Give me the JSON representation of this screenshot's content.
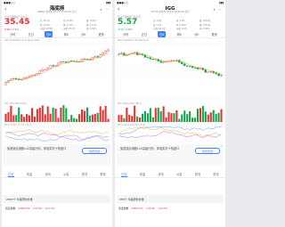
{
  "phones": [
    {
      "statusbar": {
        "left": "●●●○○",
        "right": "▮▮▮"
      },
      "title": "海底捞",
      "subtitle": "06862 交易中 07-16 15:06:49 北京",
      "tagline": "互动互通数据产品交互",
      "quote": {
        "price": "35.45",
        "change": "0.60 1.72%",
        "stats": [
          {
            "label": "高",
            "value": "36.13"
          },
          {
            "label": "开",
            "value": "34.80"
          },
          {
            "label": "量",
            "value": "765万"
          },
          {
            "label": "低",
            "value": "34.60"
          },
          {
            "label": "换",
            "value": "0.31%"
          },
          {
            "label": "额",
            "value": "2.71亿"
          },
          {
            "label": "市值",
            "value": "1879亿"
          },
          {
            "label": "市盈",
            "value": "87.53"
          },
          {
            "label": "振",
            "value": "4.39%"
          }
        ]
      },
      "tabs": [
        "分时",
        "五日",
        "日K",
        "周K",
        "月K",
        "更多"
      ],
      "active_tab": 2,
      "ma_label": "MA5 34.86  MA10 34.11  MA20 33.56",
      "vol_label": "VOL 765万  MA5 1012万",
      "kdj_label": "KDJ K:71.62 D:72.37 J:70.11",
      "promo": {
        "text": "免费激活港股Lv2高级行情，体验实时十档盘口",
        "button": "免费激活",
        "close": "✕"
      },
      "bottom_tabs": [
        "讨论",
        "资金",
        "资讯",
        "公告",
        "简况",
        "财务"
      ],
      "active_bottom_tab": 0,
      "news": {
        "text": "2053个 牛股研判文章",
        "arrow": "›"
      },
      "index_row": {
        "name": "恒生指数",
        "value": "24452.00",
        "change": "+31.60",
        "pct": "+0.13%"
      },
      "colors": {
        "up": "#e93030",
        "down": "#14a44c"
      }
    },
    {
      "statusbar": {
        "left": "●●●○○",
        "right": "▮▮▮"
      },
      "title": "IGG",
      "subtitle": "00799 交易中 07-16 15:06:49 北京",
      "tagline": "互动互通数据产品交互",
      "quote": {
        "price": "5.57",
        "change": "-0.17 -3.0%",
        "stats": [
          {
            "label": "高",
            "value": "5.65"
          },
          {
            "label": "开",
            "value": "5.64"
          },
          {
            "label": "量",
            "value": "1032万"
          },
          {
            "label": "低",
            "value": "5.53"
          },
          {
            "label": "换",
            "value": "0.86%"
          },
          {
            "label": "额",
            "value": "5744万"
          },
          {
            "label": "市值",
            "value": "66.9亿"
          },
          {
            "label": "市盈",
            "value": "9.05"
          },
          {
            "label": "振",
            "value": "2.09%"
          }
        ]
      },
      "tabs": [
        "分时",
        "五日",
        "日K",
        "周K",
        "月K",
        "更多"
      ],
      "active_tab": 2,
      "ma_label": "MA5 5.69  MA10 5.83  MA20 6.02",
      "vol_label": "VOL 1032万  MA5 1481万",
      "kdj_label": "KDJ K:18.44 D:21.08 J:13.16",
      "promo": {
        "text": "免费激活港股Lv2高级行情，体验实时十档盘口",
        "button": "免费激活",
        "close": "✕"
      },
      "bottom_tabs": [
        "讨论",
        "资金",
        "资讯",
        "公告",
        "简况",
        "财务"
      ],
      "active_bottom_tab": 0,
      "news": {
        "text": "358个 牛股研判文章",
        "arrow": "›"
      },
      "index_row": {
        "name": "恒生指数",
        "value": "24452.00",
        "change": "+31.60",
        "pct": "+0.13%"
      },
      "colors": {
        "up": "#e93030",
        "down": "#14a44c"
      }
    }
  ]
}
